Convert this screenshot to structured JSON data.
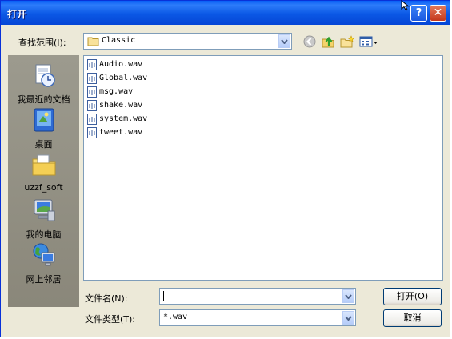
{
  "window": {
    "title": "打开"
  },
  "titlebar": {
    "help_label": "?",
    "close_label": "✕"
  },
  "lookin": {
    "label": "查找范围(I):",
    "value": "Classic"
  },
  "places": [
    {
      "label": "我最近的文档",
      "icon": "recent-documents-icon"
    },
    {
      "label": "桌面",
      "icon": "desktop-icon"
    },
    {
      "label": "uzzf_soft",
      "icon": "my-documents-icon"
    },
    {
      "label": "我的电脑",
      "icon": "my-computer-icon"
    },
    {
      "label": "网上邻居",
      "icon": "network-places-icon"
    }
  ],
  "files": [
    {
      "name": "Audio.wav"
    },
    {
      "name": "Global.wav"
    },
    {
      "name": "msg.wav"
    },
    {
      "name": "shake.wav"
    },
    {
      "name": "system.wav"
    },
    {
      "name": "tweet.wav"
    }
  ],
  "filename": {
    "label": "文件名(N):",
    "value": ""
  },
  "filetype": {
    "label": "文件类型(T):",
    "value": "*.wav"
  },
  "buttons": {
    "open": "打开(O)",
    "cancel": "取消"
  }
}
